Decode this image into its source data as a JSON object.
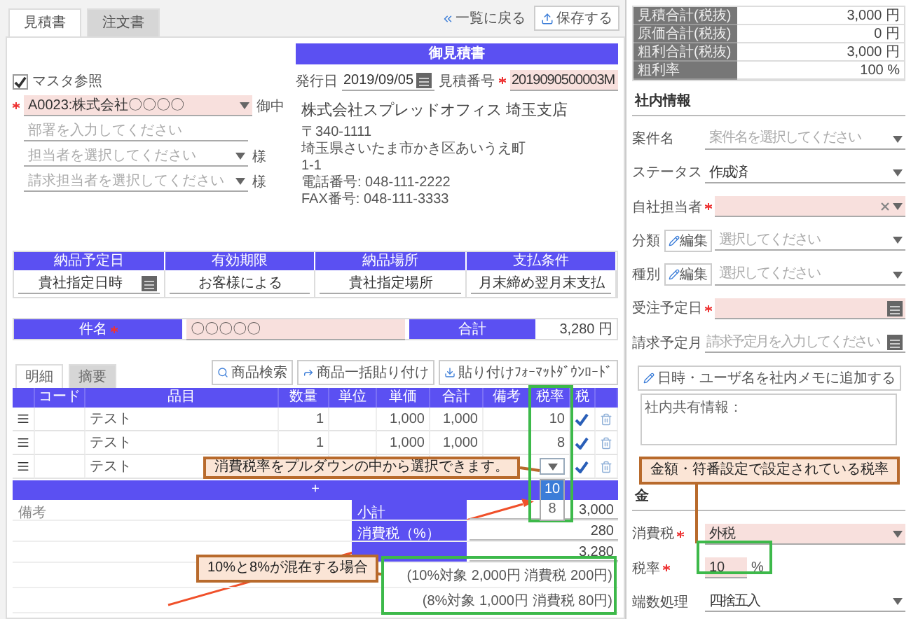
{
  "tabs": [
    {
      "label": "見積書",
      "selected": true
    },
    {
      "label": "注文書",
      "selected": false
    }
  ],
  "top_actions": {
    "back_link": "一覧に戻る",
    "save_button": "保存する"
  },
  "document": {
    "title": "御見積書",
    "issue_date_label": "発行日",
    "issue_date": "2019/09/05",
    "number_label": "見積番号",
    "number": "2019090500003M",
    "number_required": true,
    "master_ref": {
      "label": "マスタ参照",
      "checked": true
    },
    "customer": {
      "value": "A0023:株式会社〇〇〇〇",
      "suffix": "御中",
      "required": true
    },
    "department": {
      "placeholder": "部署を入力してください"
    },
    "contact": {
      "placeholder": "担当者を選択してください",
      "suffix": "様"
    },
    "billing_contact": {
      "placeholder": "請求担当者を選択してください",
      "suffix": "様"
    },
    "company": {
      "name": "株式会社スプレッドオフィス 埼玉支店",
      "lines": [
        "〒340-1111",
        "埼玉県さいたま市かき区あいうえ町",
        "1-1",
        "電話番号: 048-111-2222",
        "FAX番号: 048-111-3333"
      ]
    }
  },
  "delivery_terms": [
    {
      "header": "納品予定日",
      "value": "貴社指定日時",
      "kind": "date"
    },
    {
      "header": "有効期限",
      "value": "お客様による",
      "kind": "text"
    },
    {
      "header": "納品場所",
      "value": "貴社指定場所",
      "kind": "text"
    },
    {
      "header": "支払条件",
      "value": "月末締め翌月末支払",
      "kind": "text"
    }
  ],
  "subject": {
    "label": "件名",
    "required": true,
    "value": "〇〇〇〇〇",
    "total_label": "合計",
    "total": "3,280 円"
  },
  "detail_tabs": [
    {
      "label": "明細",
      "selected": true
    },
    {
      "label": "摘要",
      "selected": false
    }
  ],
  "detail_buttons": [
    "商品検索",
    "商品一括貼り付け",
    "貼り付けﾌｫｰﾏｯﾄﾀﾞｳﾝﾛｰﾄﾞ"
  ],
  "items": {
    "columns": [
      "コード",
      "品目",
      "数量",
      "単位",
      "単価",
      "合計",
      "備考",
      "税率",
      "税"
    ],
    "rows": [
      {
        "item": "テスト",
        "qty": "1",
        "price": "1,000",
        "total": "1,000",
        "kind": "text",
        "tax_rate": "10",
        "taxable": true
      },
      {
        "item": "テスト",
        "qty": "1",
        "price": "1,000",
        "total": "1,000",
        "kind": "text",
        "tax_rate": "8",
        "taxable": true
      },
      {
        "item": "テスト",
        "kind": "dropdown",
        "taxable": true,
        "options": [
          {
            "label": "10",
            "selected": true
          },
          {
            "label": "8",
            "selected": false
          }
        ]
      }
    ],
    "add_row_label": "+"
  },
  "remarks_label": "備考",
  "summary": [
    {
      "label": "小計",
      "value": "3,000"
    },
    {
      "label": "消費税（%）",
      "value": "280"
    },
    {
      "value": "3,280"
    }
  ],
  "tax_breakdown": [
    "(10%対象 2,000円 消費税 200円)",
    "(8%対象 1,000円 消費税 80円)"
  ],
  "side": {
    "totals": [
      {
        "label": "見積合計(税抜)",
        "value": "3,000 円"
      },
      {
        "label": "原価合計(税抜)",
        "value": "0 円"
      },
      {
        "label": "粗利合計(税抜)",
        "value": "3,000 円"
      },
      {
        "label": "粗利率",
        "value": "100 %"
      }
    ],
    "section_title": "社内情報",
    "fields": [
      {
        "label": "案件名",
        "kind": "select",
        "placeholder": "案件名を選択してください",
        "required": false
      },
      {
        "label": "ステータス",
        "kind": "select",
        "value": "作成済",
        "required": false
      },
      {
        "label": "自社担当者",
        "kind": "select_clear",
        "required": true
      },
      {
        "label": "分類",
        "kind": "select",
        "edit_button": "編集",
        "placeholder": "選択してください",
        "required": false
      },
      {
        "label": "種別",
        "kind": "select",
        "edit_button": "編集",
        "placeholder": "選択してください",
        "required": false
      },
      {
        "label": "受注予定日",
        "kind": "date",
        "required": true
      },
      {
        "label": "請求予定月",
        "kind": "date",
        "placeholder": "請求予定月を入力してください",
        "required": false
      }
    ],
    "memo_button": "日時・ユーザ名を社内メモに追加する",
    "memo_value": "社内共有情報：",
    "tax_section_title": "金",
    "tax_fields": [
      {
        "label": "消費税",
        "kind": "select",
        "value": "外税",
        "required": true
      },
      {
        "label": "税率",
        "kind": "percent",
        "value": "10",
        "unit": "%",
        "required": true
      },
      {
        "label": "端数処理",
        "kind": "select",
        "value": "四捨五入",
        "required": false
      }
    ]
  },
  "callouts": [
    "消費税率をプルダウンの中から選択できます。",
    "10%と8%が混在する場合",
    "金額・符番設定で設定されている税率"
  ]
}
